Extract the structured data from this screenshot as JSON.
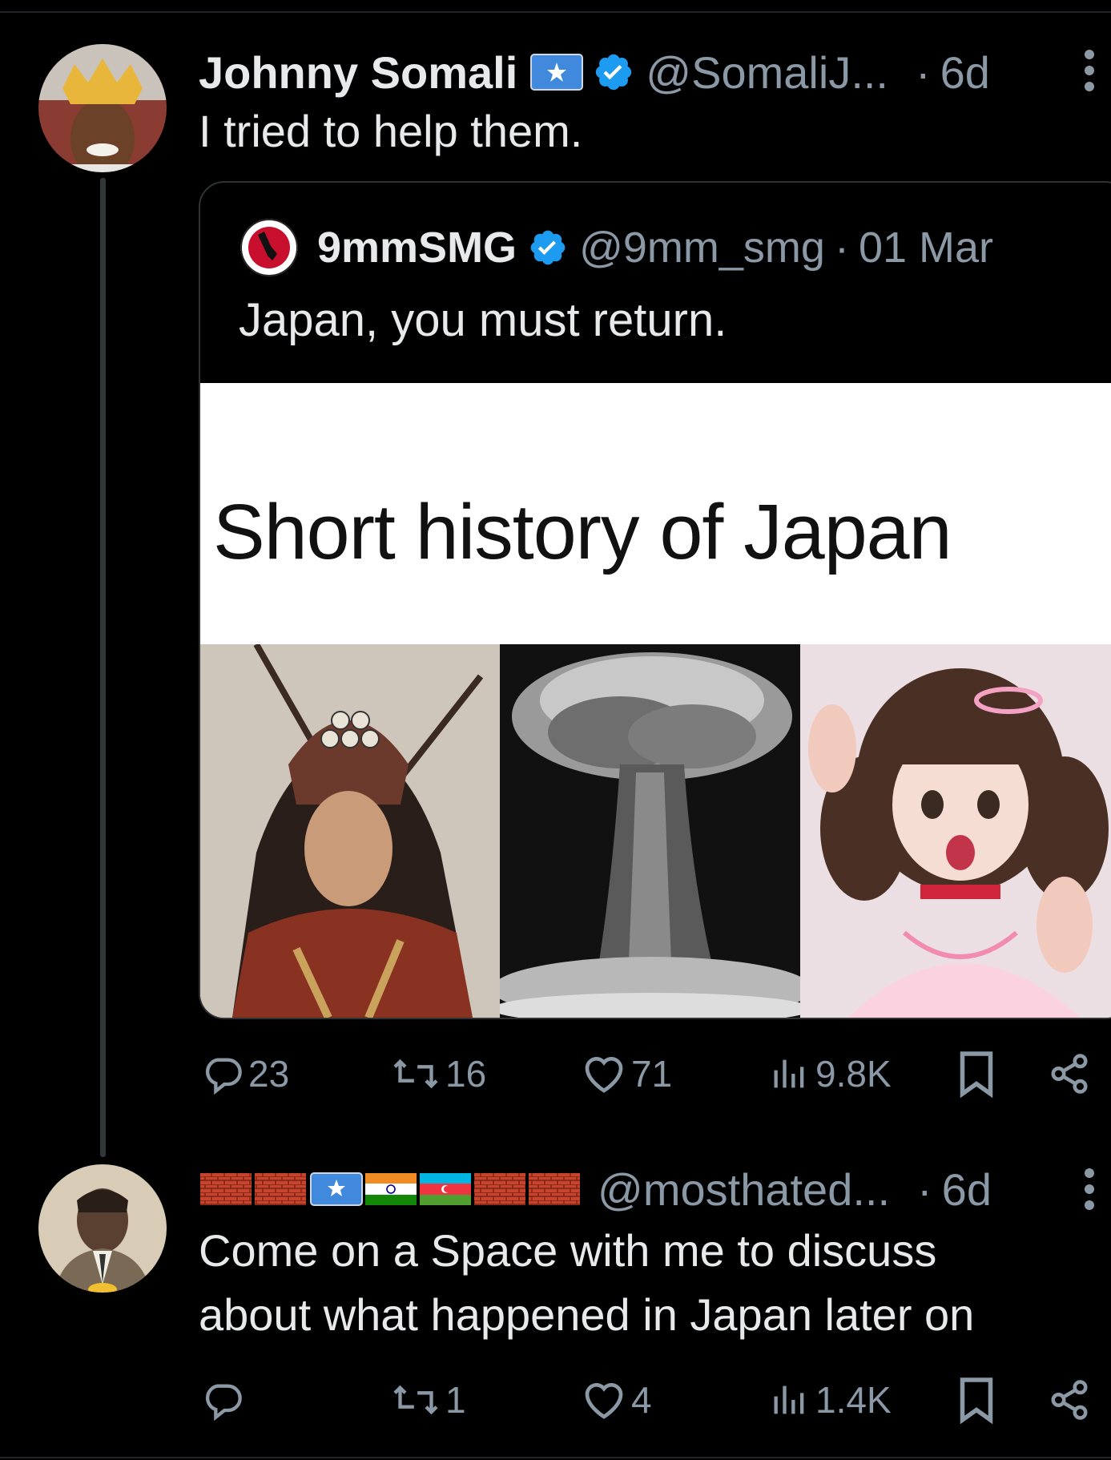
{
  "tweet1": {
    "name": "Johnny Somali",
    "handle": "@SomaliJ...",
    "separator": "·",
    "time": "6d",
    "text": "I tried to help them."
  },
  "quote": {
    "name": "9mmSMG",
    "handle": "@9mm_smg",
    "separator": "·",
    "date": "01 Mar",
    "text": "Japan, you must return.",
    "meme_title": "Short history of Japan"
  },
  "actions1": {
    "replies": "23",
    "reposts": "16",
    "likes": "71",
    "views": "9.8K"
  },
  "tweet2": {
    "handle": "@mosthated...",
    "separator": "·",
    "time": "6d",
    "text_line1": "Come on a Space with me to discuss",
    "text_line2": "about what happened in Japan later on"
  },
  "actions2": {
    "replies": "",
    "reposts": "1",
    "likes": "4",
    "views": "1.4K"
  },
  "colors": {
    "background": "#000000",
    "text": "#e7e9ea",
    "muted": "#8b98a5",
    "verified": "#1d9bf0",
    "border": "#2f3336"
  }
}
